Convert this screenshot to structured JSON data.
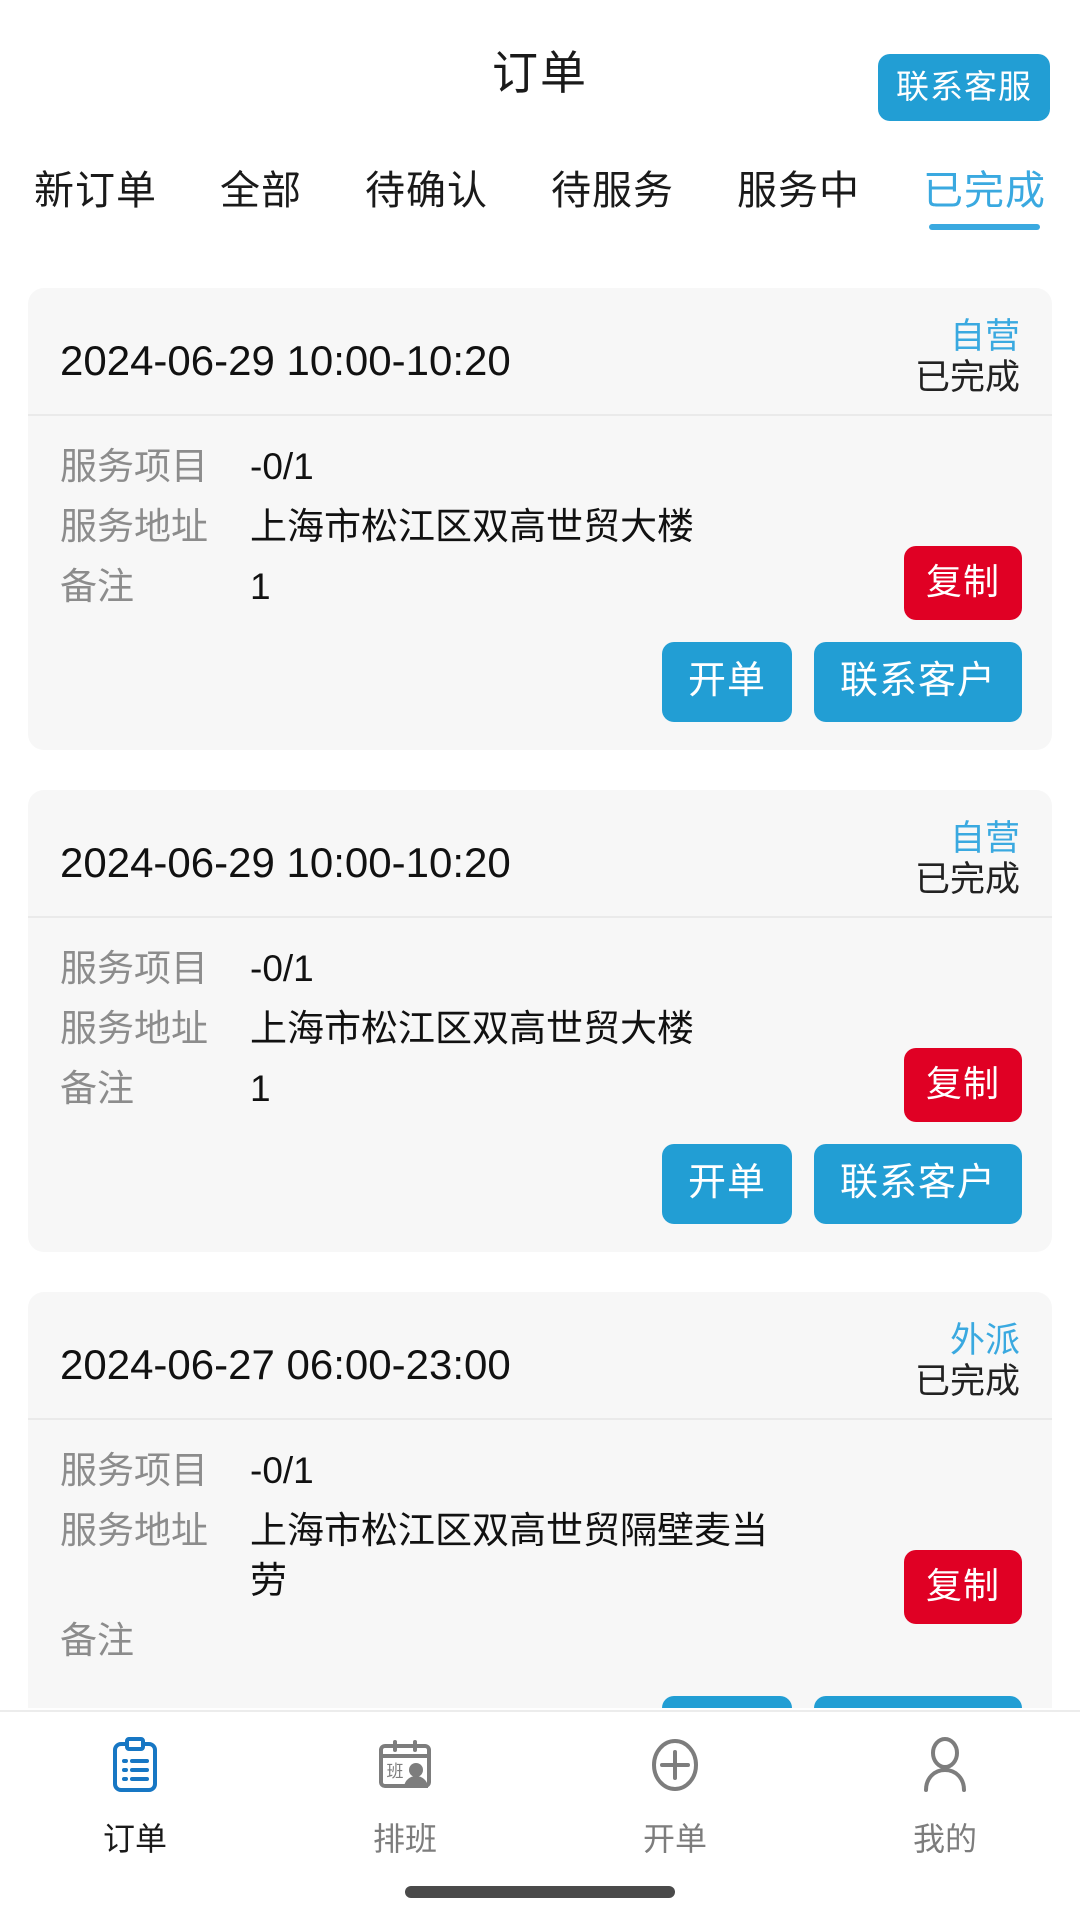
{
  "header": {
    "title": "订单",
    "support_button": "联系客服"
  },
  "tabs": [
    {
      "label": "新订单",
      "active": false
    },
    {
      "label": "全部",
      "active": false
    },
    {
      "label": "待确认",
      "active": false
    },
    {
      "label": "待服务",
      "active": false
    },
    {
      "label": "服务中",
      "active": false
    },
    {
      "label": "已完成",
      "active": true
    }
  ],
  "labels": {
    "service_item": "服务项目",
    "service_address": "服务地址",
    "remark": "备注",
    "copy": "复制",
    "create_order": "开单",
    "contact_customer": "联系客户"
  },
  "orders": [
    {
      "datetime": "2024-06-29 10:00-10:20",
      "type": "自营",
      "status": "已完成",
      "service_item": "-0/1",
      "address": "上海市松江区双高世贸大楼",
      "remark": "1"
    },
    {
      "datetime": "2024-06-29 10:00-10:20",
      "type": "自营",
      "status": "已完成",
      "service_item": "-0/1",
      "address": "上海市松江区双高世贸大楼",
      "remark": "1"
    },
    {
      "datetime": "2024-06-27 06:00-23:00",
      "type": "外派",
      "status": "已完成",
      "service_item": "-0/1",
      "address": "上海市松江区双高世贸隔壁麦当劳",
      "remark": ""
    }
  ],
  "bottom_nav": [
    {
      "label": "订单",
      "icon": "clipboard-list-icon",
      "active": true
    },
    {
      "label": "排班",
      "icon": "calendar-person-icon",
      "active": false
    },
    {
      "label": "开单",
      "icon": "plus-circle-icon",
      "active": false
    },
    {
      "label": "我的",
      "icon": "person-icon",
      "active": false
    }
  ],
  "colors": {
    "accent_blue": "#229ed4",
    "tab_active": "#3aa9e0",
    "copy_red": "#e00024",
    "card_bg": "#f7f7f7"
  }
}
